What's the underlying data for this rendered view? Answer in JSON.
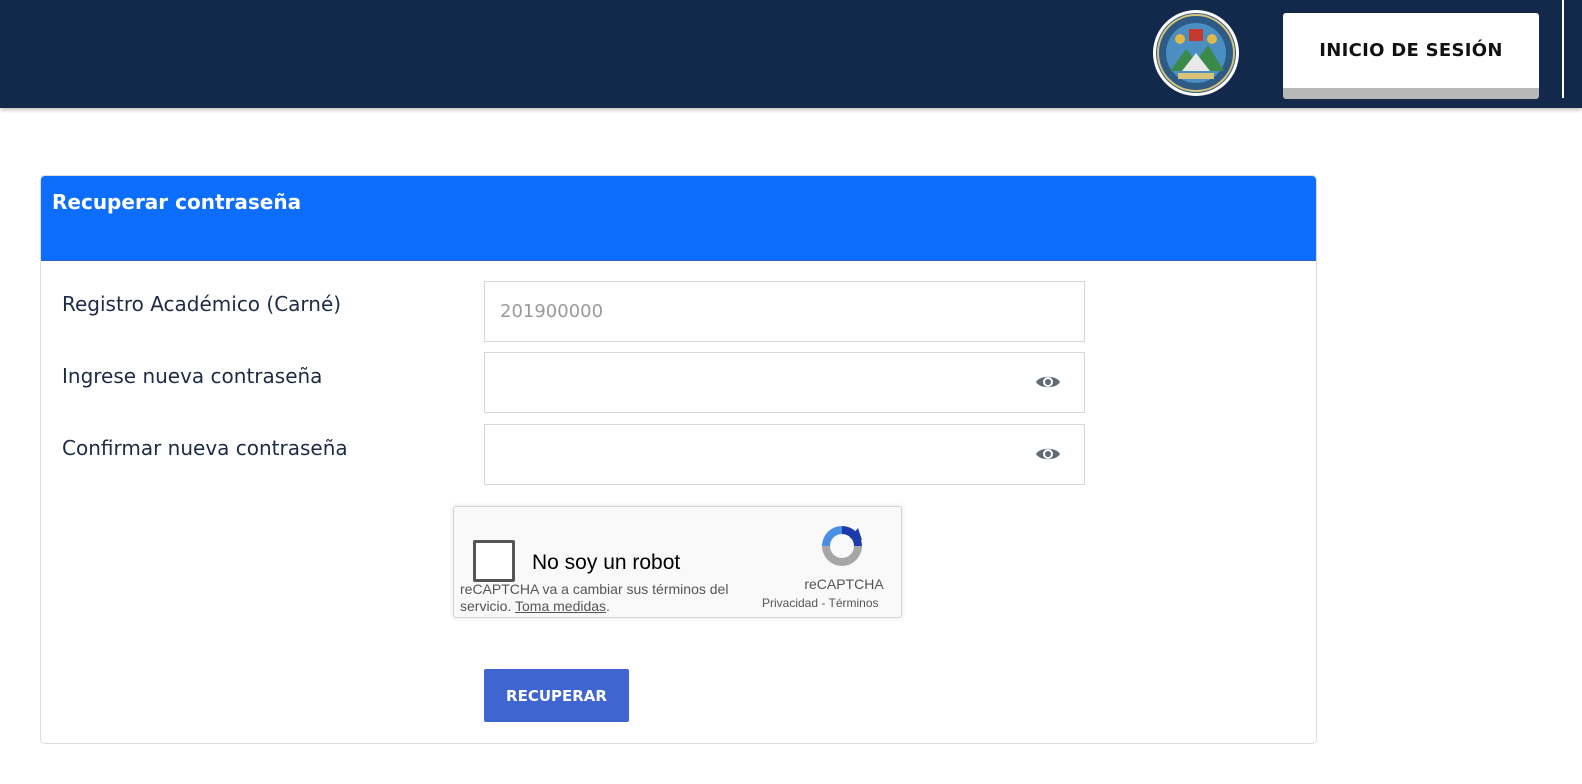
{
  "header": {
    "seal_icon": "university-seal-icon",
    "login_button": "INICIO DE SESIÓN",
    "background_color": "#13294b"
  },
  "card": {
    "title": "Recuperar contraseña",
    "header_color": "#0d6efd",
    "fields": {
      "carne": {
        "label": "Registro Académico (Carné)",
        "value": "",
        "placeholder": "201900000"
      },
      "new_password": {
        "label": "Ingrese nueva contraseña",
        "value": "",
        "icon": "eye-icon"
      },
      "confirm_password": {
        "label": "Confirmar nueva contraseña",
        "value": "",
        "icon": "eye-icon"
      }
    },
    "recaptcha": {
      "checkbox_label": "No soy un robot",
      "brand": "reCAPTCHA",
      "privacy": "Privacidad",
      "separator": "-",
      "terms": "Términos",
      "notice_text": "reCAPTCHA va a cambiar sus términos del servicio.",
      "notice_link": "Toma medidas",
      "notice_end": "."
    },
    "submit_button": "RECUPERAR",
    "submit_color": "#3f66d0"
  }
}
